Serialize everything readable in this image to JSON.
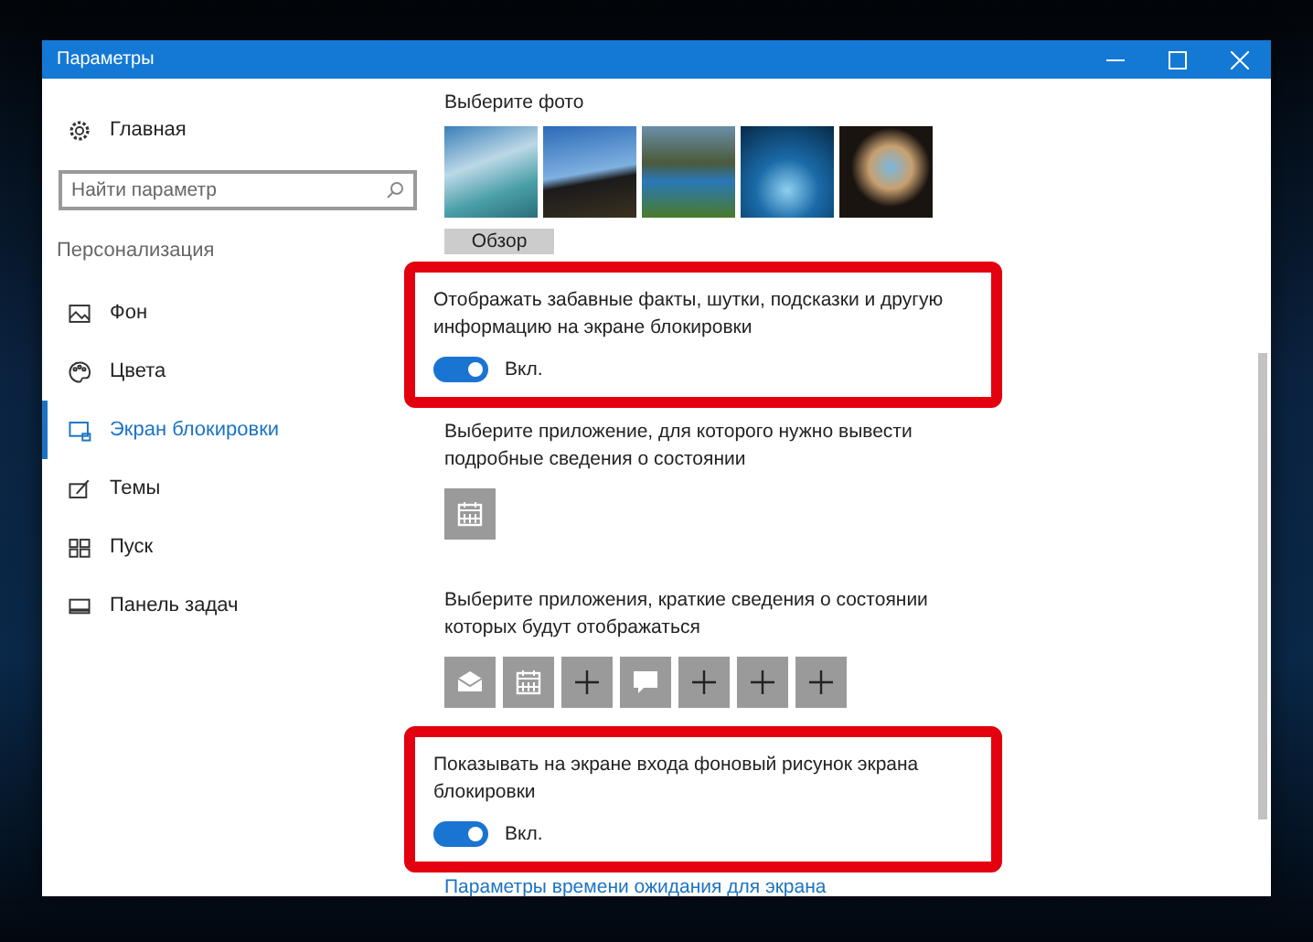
{
  "window": {
    "title": "Параметры"
  },
  "sidebar": {
    "home": "Главная",
    "search": {
      "placeholder": "Найти параметр"
    },
    "section": "Персонализация",
    "items": [
      {
        "label": "Фон",
        "kind": "picture",
        "selected": false
      },
      {
        "label": "Цвета",
        "kind": "palette",
        "selected": false
      },
      {
        "label": "Экран блокировки",
        "kind": "lockscreen",
        "selected": true
      },
      {
        "label": "Темы",
        "kind": "themes",
        "selected": false
      },
      {
        "label": "Пуск",
        "kind": "start",
        "selected": false
      },
      {
        "label": "Панель задач",
        "kind": "taskbar",
        "selected": false
      }
    ]
  },
  "content": {
    "photo_title": "Выберите фото",
    "browse_button": "Обзор",
    "fun_facts": {
      "label": "Отображать забавные факты, шутки, подсказки и другую информацию на экране блокировки",
      "on": true,
      "state": "Вкл.",
      "highlighted": true
    },
    "detail_app": {
      "label": "Выберите приложение, для которого нужно вывести подробные сведения о состоянии",
      "tiles": [
        {
          "kind": "calendar"
        }
      ]
    },
    "quick_apps": {
      "label": "Выберите приложения, краткие сведения о состоянии которых будут отображаться",
      "tiles": [
        {
          "kind": "mail"
        },
        {
          "kind": "calendar"
        },
        {
          "kind": "add"
        },
        {
          "kind": "chat"
        },
        {
          "kind": "add"
        },
        {
          "kind": "add"
        },
        {
          "kind": "add"
        }
      ]
    },
    "signin_background": {
      "label": "Показывать на экране входа фоновый рисунок экрана блокировки",
      "on": true,
      "state": "Вкл.",
      "highlighted": true
    },
    "timeout_link": "Параметры времени ожидания для экрана"
  }
}
